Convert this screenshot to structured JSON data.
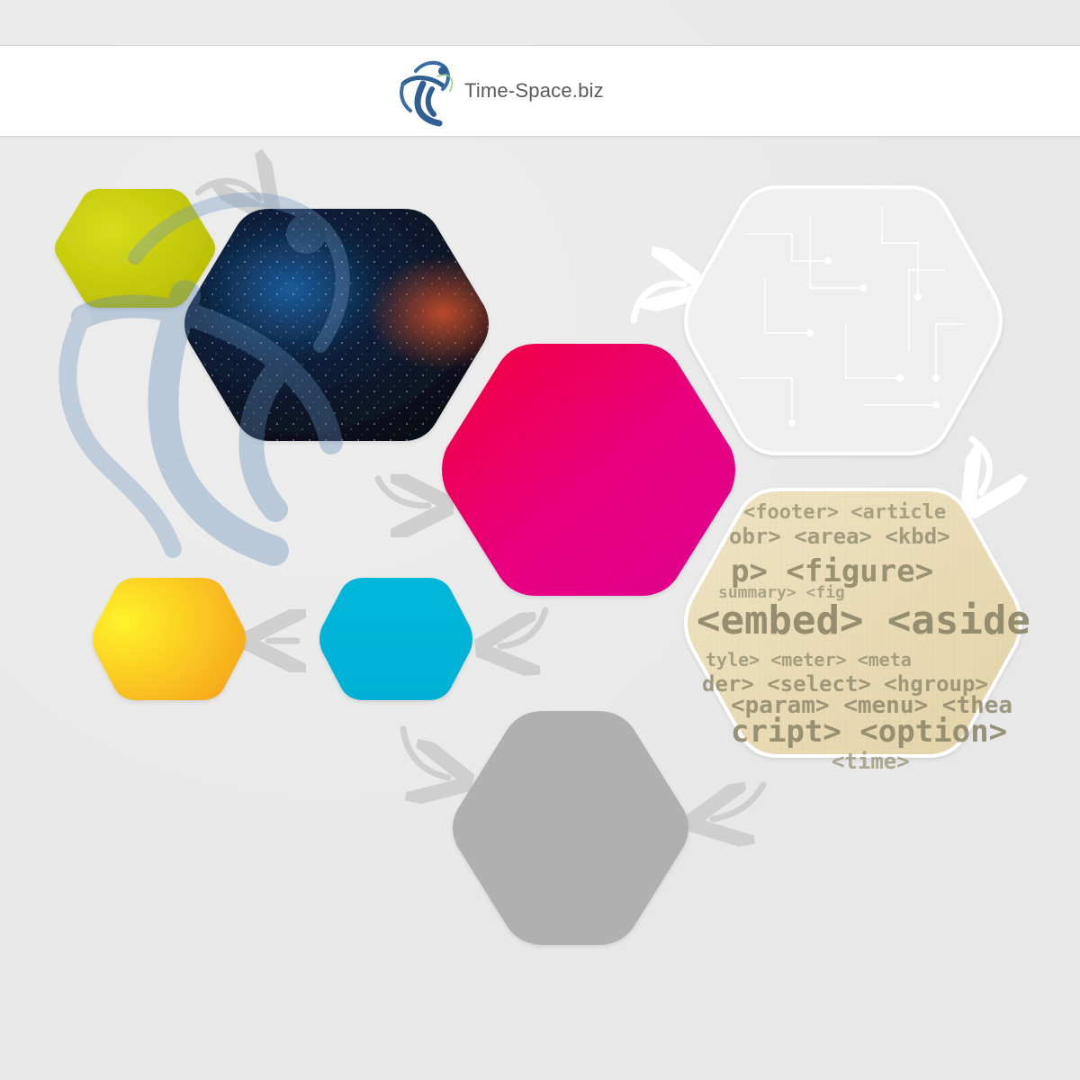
{
  "header": {
    "brand_name": "Time-Space.biz",
    "logo_icon": "dancing-figure-logo-icon"
  },
  "hexagons": [
    {
      "id": "lime",
      "color": "#c3c700",
      "icon": "lime-hexagon"
    },
    {
      "id": "space",
      "color": "#0a1020",
      "icon": "galaxy-hexagon"
    },
    {
      "id": "magenta",
      "color": "#e8007a",
      "icon": "magenta-hexagon"
    },
    {
      "id": "circuit",
      "color": "#e6e6e6",
      "icon": "circuit-board-hexagon"
    },
    {
      "id": "html-tags",
      "color": "#e8dcb4",
      "icon": "html-tags-hexagon"
    },
    {
      "id": "gray",
      "color": "#b0b0b0",
      "icon": "gray-hexagon"
    },
    {
      "id": "cyan",
      "color": "#00b4d8",
      "icon": "cyan-hexagon"
    },
    {
      "id": "yellow",
      "color": "#fbc02d",
      "icon": "yellow-hexagon"
    }
  ],
  "html_tags": {
    "lines": [
      "<footer> <article",
      "obr> <area> <kbd>",
      "p> <figure>",
      "summary> <fig",
      "<embed> <aside",
      "tyle> <meter> <meta",
      "der> <select> <hgroup>",
      "<param> <menu> <thea",
      "cript> <option>",
      "<time>"
    ]
  },
  "arrows": [
    {
      "id": "lime-to-space",
      "icon": "curved-arrow-icon"
    },
    {
      "id": "magenta-to-circuit",
      "icon": "curved-arrow-icon"
    },
    {
      "id": "circuit-to-tags",
      "icon": "curved-arrow-icon"
    },
    {
      "id": "tags-to-gray",
      "icon": "curved-arrow-icon"
    },
    {
      "id": "space-to-magenta",
      "icon": "curved-arrow-icon"
    },
    {
      "id": "magenta-to-cyan",
      "icon": "curved-arrow-icon"
    },
    {
      "id": "cyan-to-yellow",
      "icon": "curved-arrow-icon"
    },
    {
      "id": "cyan-to-gray",
      "icon": "curved-arrow-icon"
    }
  ]
}
